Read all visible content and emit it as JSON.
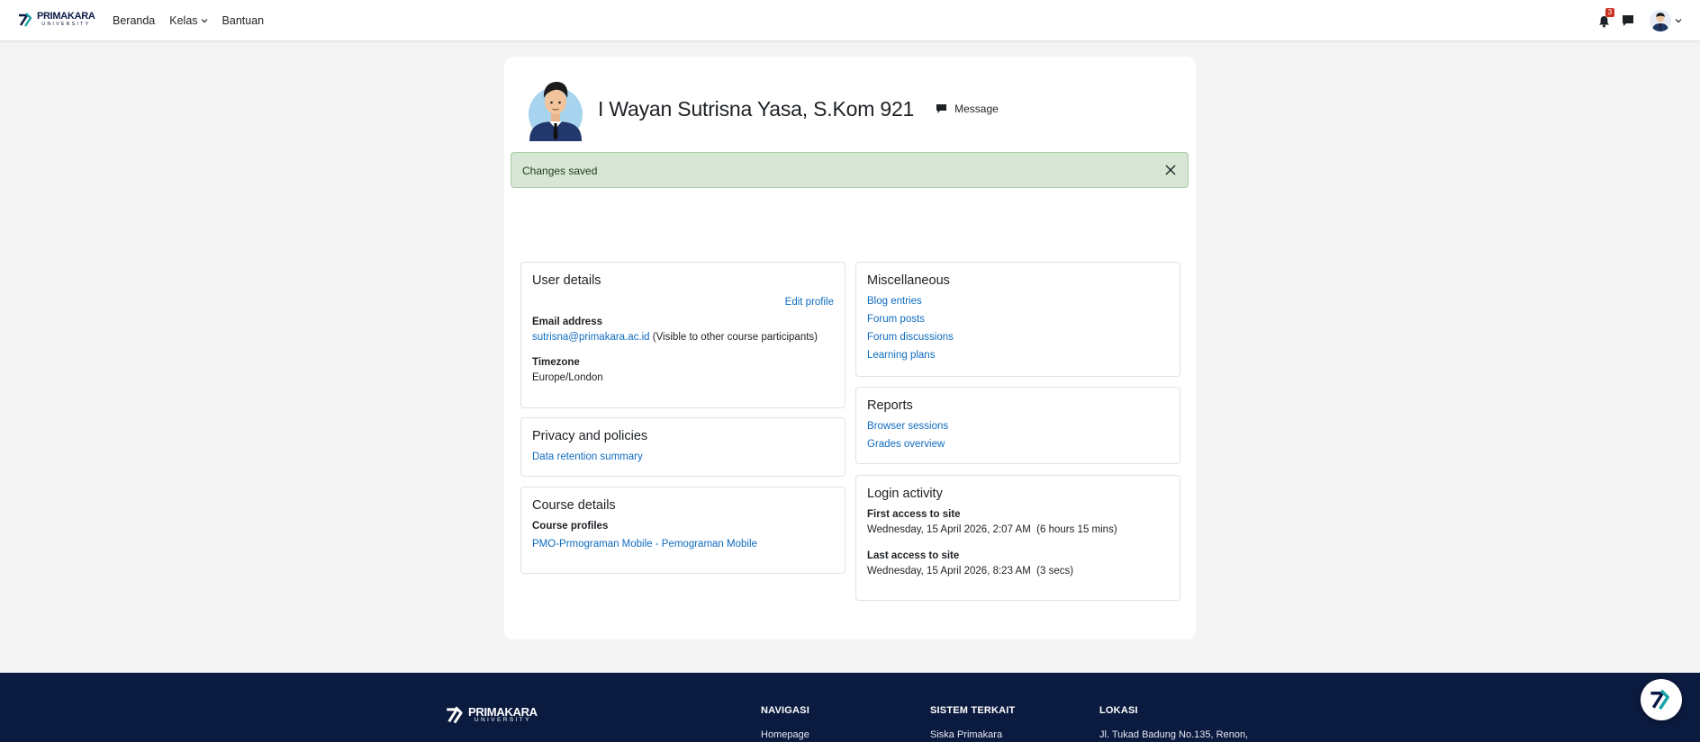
{
  "brand": {
    "name": "PRIMAKARA",
    "subtitle": "UNIVERSITY",
    "primary_color": "#0b1a44",
    "accent_color": "#1aa3a8"
  },
  "nav": {
    "items": [
      {
        "label": "Beranda"
      },
      {
        "label": "Kelas"
      },
      {
        "label": "Bantuan"
      }
    ],
    "notification_count": "3"
  },
  "profile": {
    "name": "I Wayan Sutrisna Yasa, S.Kom 921",
    "message_label": "Message"
  },
  "alert": {
    "text": "Changes saved",
    "color": "#d7e6d5"
  },
  "user_details": {
    "title": "User details",
    "edit_label": "Edit profile",
    "email_label": "Email address",
    "email": "sutrisna@primakara.ac.id",
    "email_note": "(Visible to other course participants)",
    "timezone_label": "Timezone",
    "timezone": "Europe/London"
  },
  "privacy": {
    "title": "Privacy and policies",
    "link": "Data retention summary"
  },
  "course_details": {
    "title": "Course details",
    "label": "Course profiles",
    "link": "PMO-Prmograman Mobile - Pemograman Mobile"
  },
  "misc": {
    "title": "Miscellaneous",
    "links": [
      "Blog entries",
      "Forum posts",
      "Forum discussions",
      "Learning plans"
    ]
  },
  "reports": {
    "title": "Reports",
    "links": [
      "Browser sessions",
      "Grades overview"
    ]
  },
  "login": {
    "title": "Login activity",
    "first_label": "First access to site",
    "first_value": "Wednesday, 15 April 2026, 2:07 AM  (6 hours 15 mins)",
    "last_label": "Last access to site",
    "last_value": "Wednesday, 15 April 2026, 8:23 AM  (3 secs)"
  },
  "footer": {
    "cols": [
      {
        "head": "NAVIGASI",
        "item": "Homepage"
      },
      {
        "head": "SISTEM TERKAIT",
        "item": "Siska Primakara"
      },
      {
        "head": "LOKASI",
        "item": "Jl. Tukad Badung No.135, Renon,"
      }
    ]
  }
}
